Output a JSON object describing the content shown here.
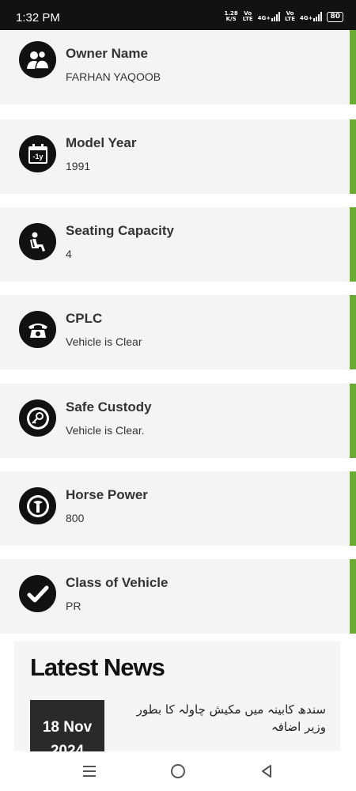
{
  "status_bar": {
    "time": "1:32 PM",
    "net_speed_value": "1.28",
    "net_speed_unit": "K/S",
    "volte_1_top": "Vo",
    "volte_1_bottom": "LTE",
    "network_1": "4G+",
    "volte_2_top": "Vo",
    "volte_2_bottom": "LTE",
    "network_2": "4G+",
    "battery": "80"
  },
  "cards": [
    {
      "title": "Owner Name",
      "value": "FARHAN YAQOOB",
      "icon": "owner-icon"
    },
    {
      "title": "Model Year",
      "value": "1991",
      "icon": "calendar-icon",
      "icon_text": "-1y"
    },
    {
      "title": "Seating Capacity",
      "value": "4",
      "icon": "seat-icon"
    },
    {
      "title": "CPLC",
      "value": "Vehicle is Clear",
      "icon": "telephone-icon"
    },
    {
      "title": "Safe Custody",
      "value": "Vehicle is Clear.",
      "icon": "key-icon"
    },
    {
      "title": "Horse Power",
      "value": "800",
      "icon": "gauge-icon"
    },
    {
      "title": "Class of Vehicle",
      "value": "PR",
      "icon": "check-icon"
    }
  ],
  "news": {
    "heading": "Latest News",
    "date_day": "18 Nov",
    "date_year": "2024",
    "headline": "سندھ کابینہ میں مکیش چاولہ کا بطور وزیر اضافہ"
  },
  "colors": {
    "accent": "#6aab34",
    "card_bg": "#f4f4f4",
    "status_bg": "#121212"
  }
}
